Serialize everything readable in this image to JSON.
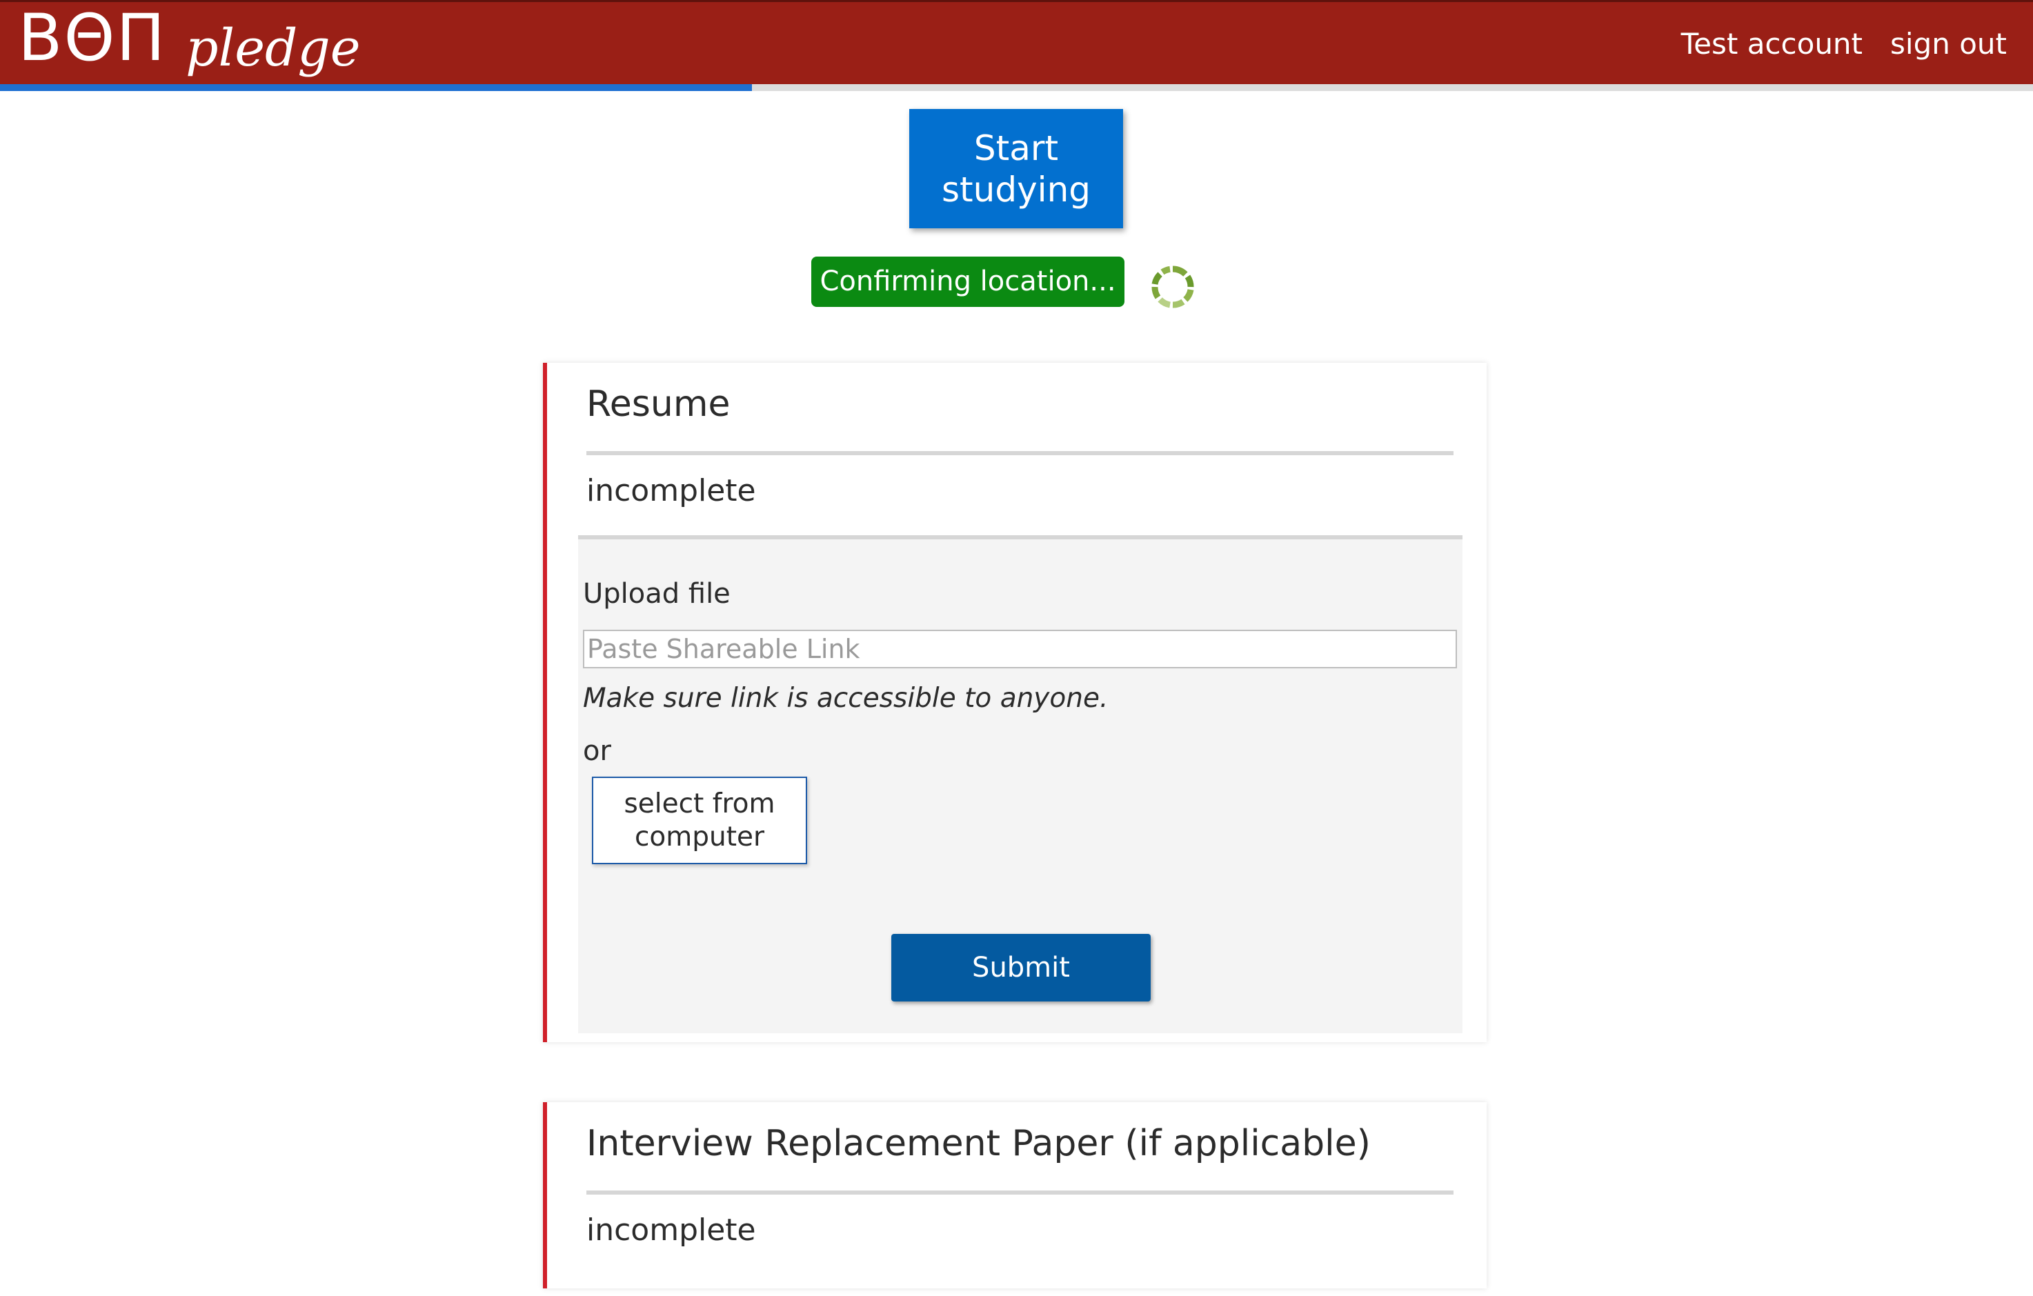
{
  "header": {
    "brand_letters": "ΒΘΠ",
    "brand_word": "pledge",
    "account_link": "Test account",
    "signout_link": "sign out",
    "background_color": "#9a1f16"
  },
  "progress": {
    "fraction": 0.37,
    "fill_color": "#1f6fd1"
  },
  "start_button": {
    "label": "Start studying"
  },
  "location_status": {
    "label": "Confirming location...",
    "spinner_icon": "loading-spinner-icon"
  },
  "cards": {
    "resume": {
      "title": "Resume",
      "status": "incomplete",
      "upload": {
        "label": "Upload file",
        "placeholder": "Paste Shareable Link",
        "hint": "Make sure link is accessible to anyone.",
        "or_text": "or",
        "select_button": "select from computer",
        "submit_button": "Submit"
      }
    },
    "interview": {
      "title": "Interview Replacement Paper (if applicable)",
      "status": "incomplete"
    }
  },
  "colors": {
    "card_accent": "#d0202a",
    "primary_button": "#0370cf",
    "submit_button": "#045aa0",
    "status_green": "#0b8a12"
  }
}
